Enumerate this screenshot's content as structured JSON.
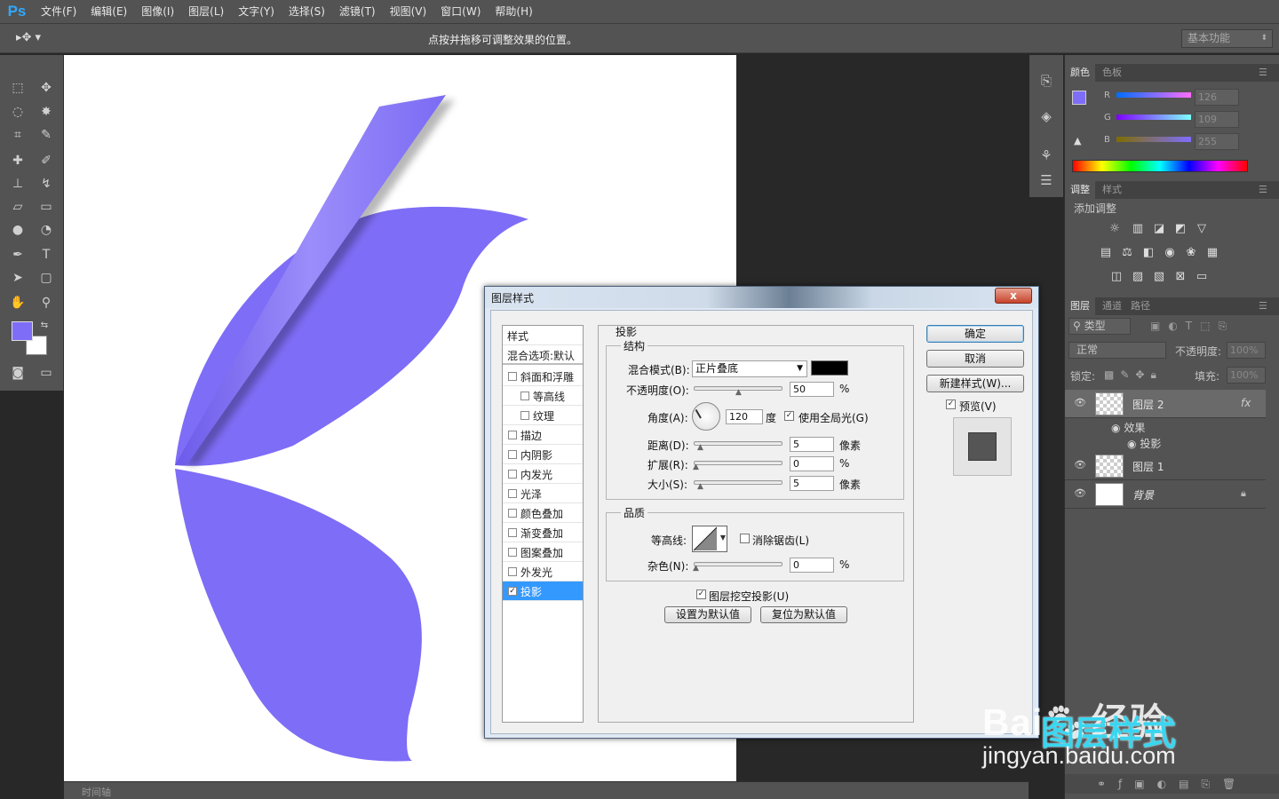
{
  "app": {
    "logo": "Ps"
  },
  "menu": [
    "文件(F)",
    "编辑(E)",
    "图像(I)",
    "图层(L)",
    "文字(Y)",
    "选择(S)",
    "滤镜(T)",
    "视图(V)",
    "窗口(W)",
    "帮助(H)"
  ],
  "options": {
    "hint": "点按并拖移可调整效果的位置。",
    "workspace": "基本功能"
  },
  "colors": {
    "foreground": "#7e6df6",
    "background": "#ffffff",
    "shape": "#7e6df6"
  },
  "color_panel": {
    "tabs": [
      "颜色",
      "色板"
    ],
    "channels": [
      {
        "label": "R",
        "value": "126"
      },
      {
        "label": "G",
        "value": "109"
      },
      {
        "label": "B",
        "value": "255"
      }
    ]
  },
  "adjust_panel": {
    "tabs": [
      "调整",
      "样式"
    ],
    "title": "添加调整"
  },
  "layers_panel": {
    "tabs": [
      "图层",
      "通道",
      "路径"
    ],
    "filter": "类型",
    "blend_mode": "正常",
    "opacity_label": "不透明度:",
    "opacity_value": "100%",
    "lock_label": "锁定:",
    "fill_label": "填充:",
    "fill_value": "100%",
    "fx_badge": "fx",
    "layers": [
      {
        "name": "图层 2",
        "effects_label": "效果",
        "effect": "投影"
      },
      {
        "name": "图层 1"
      },
      {
        "name": "背景"
      }
    ]
  },
  "timeline": {
    "label": "时间轴"
  },
  "dialog": {
    "title": "图层样式",
    "close": "x",
    "styles_header": "样式",
    "blend_options": "混合选项:默认",
    "styles": [
      {
        "label": "斜面和浮雕",
        "checked": false,
        "indent": false
      },
      {
        "label": "等高线",
        "checked": false,
        "indent": true
      },
      {
        "label": "纹理",
        "checked": false,
        "indent": true
      },
      {
        "label": "描边",
        "checked": false,
        "indent": false
      },
      {
        "label": "内阴影",
        "checked": false,
        "indent": false
      },
      {
        "label": "内发光",
        "checked": false,
        "indent": false
      },
      {
        "label": "光泽",
        "checked": false,
        "indent": false
      },
      {
        "label": "颜色叠加",
        "checked": false,
        "indent": false
      },
      {
        "label": "渐变叠加",
        "checked": false,
        "indent": false
      },
      {
        "label": "图案叠加",
        "checked": false,
        "indent": false
      },
      {
        "label": "外发光",
        "checked": false,
        "indent": false
      },
      {
        "label": "投影",
        "checked": true,
        "indent": false,
        "selected": true
      }
    ],
    "section_title": "投影",
    "structure": {
      "title": "结构",
      "blend_mode_label": "混合模式(B):",
      "blend_mode_value": "正片叠底",
      "shadow_color": "#000000",
      "opacity_label": "不透明度(O):",
      "opacity_value": "50",
      "percent": "%",
      "angle_label": "角度(A):",
      "angle_value": "120",
      "degree_unit": "度",
      "global_light_label": "使用全局光(G)",
      "distance_label": "距离(D):",
      "distance_value": "5",
      "spread_label": "扩展(R):",
      "spread_value": "0",
      "size_label": "大小(S):",
      "size_value": "5",
      "pixel_unit": "像素"
    },
    "quality": {
      "title": "品质",
      "contour_label": "等高线:",
      "antialias_label": "消除锯齿(L)",
      "noise_label": "杂色(N):",
      "noise_value": "0"
    },
    "knockout_label": "图层挖空投影(U)",
    "make_default": "设置为默认值",
    "reset_default": "复位为默认值",
    "ok": "确定",
    "cancel": "取消",
    "new_style": "新建样式(W)...",
    "preview_label": "预览(V)"
  },
  "watermark": {
    "brand": "Bai",
    "caption": "图层样式",
    "brand2": "经验",
    "url": "jingyan.baidu.com"
  }
}
